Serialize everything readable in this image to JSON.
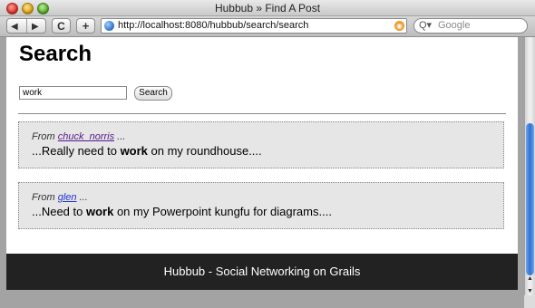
{
  "window": {
    "title": "Hubbub » Find A Post"
  },
  "toolbar": {
    "back_glyph": "◀",
    "forward_glyph": "▶",
    "reload_glyph": "C",
    "add_glyph": "+",
    "url": "http://localhost:8080/hubbub/search/search",
    "search_placeholder": "Google",
    "search_glyph": "Q▾"
  },
  "page": {
    "title": "Search",
    "search": {
      "value": "work",
      "button_label": "Search"
    },
    "posts": [
      {
        "from_label": "From",
        "author": "chuck_norris",
        "ellipsis": "...",
        "msg_before": "...Really need to ",
        "highlight": "work",
        "msg_after": " on my roundhouse...."
      },
      {
        "from_label": "From",
        "author": "glen",
        "ellipsis": "...",
        "msg_before": "...Need to ",
        "highlight": "work",
        "msg_after": " on my Powerpoint kungfu for diagrams...."
      }
    ],
    "footer": "Hubbub - Social Networking on Grails"
  },
  "colors": {
    "footer_bg": "#222222",
    "post_bg": "#e6e6e6",
    "visited_link": "#551a8b",
    "link": "#2233cc",
    "scroll_thumb": "#2f6fd2"
  }
}
